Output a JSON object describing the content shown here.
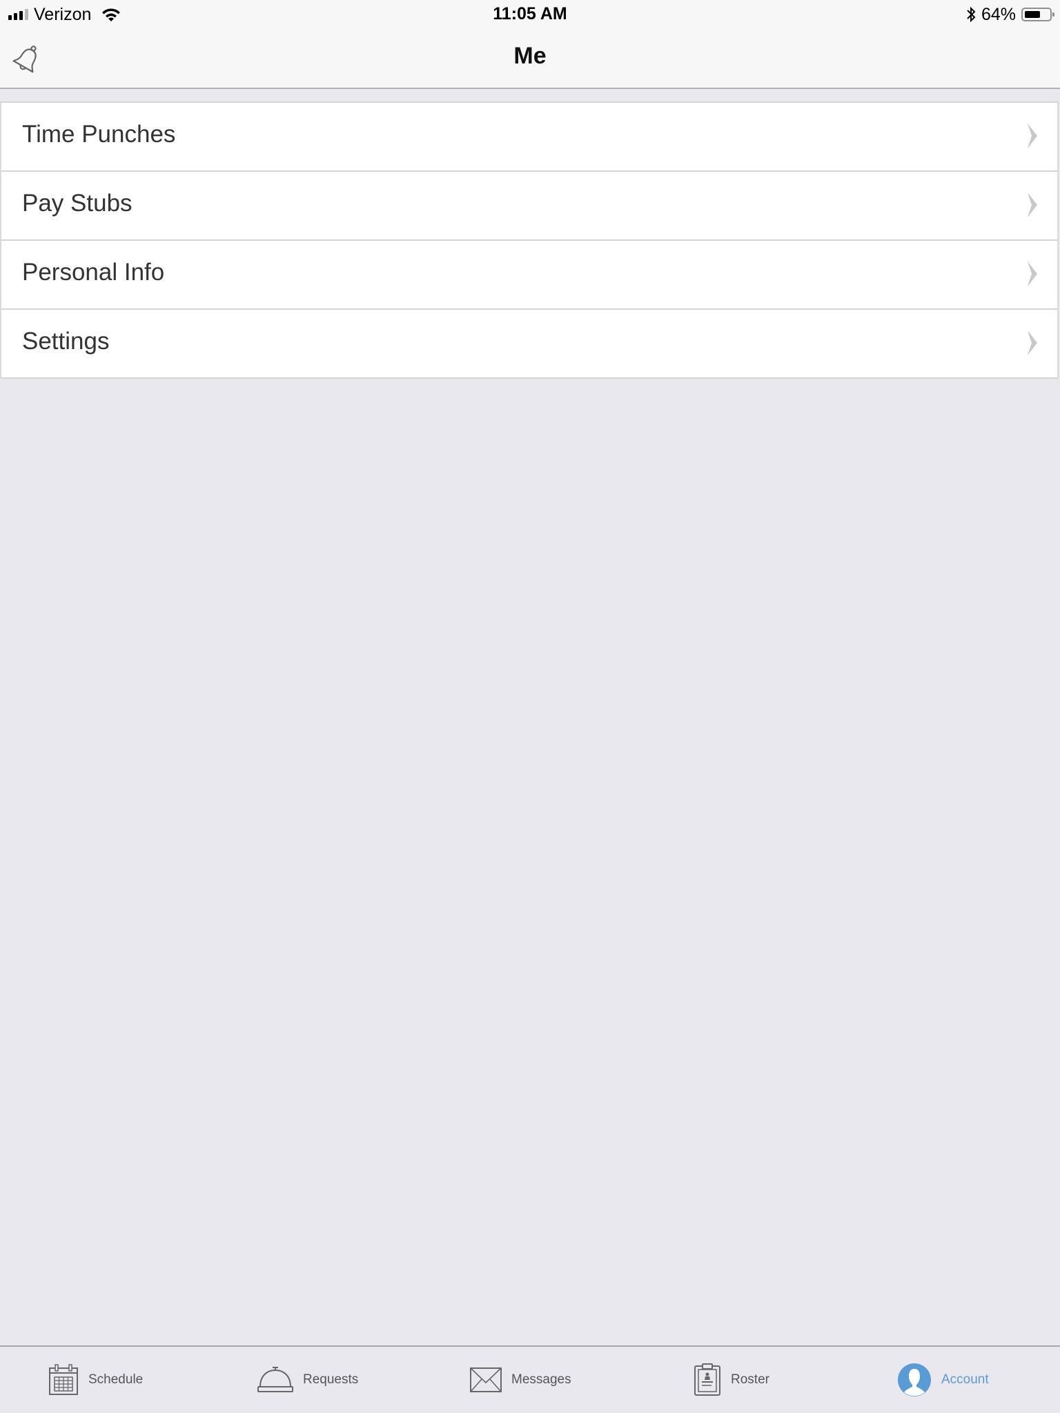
{
  "status_bar": {
    "carrier": "Verizon",
    "signal_bars": 3,
    "signal_max": 4,
    "time": "11:05 AM",
    "battery_text": "64%",
    "battery_level": 0.64
  },
  "nav": {
    "title": "Me",
    "left_icon": "bell-icon"
  },
  "menu": {
    "items": [
      {
        "label": "Time Punches",
        "icon": "chevron-right-icon"
      },
      {
        "label": "Pay Stubs",
        "icon": "chevron-right-icon"
      },
      {
        "label": "Personal Info",
        "icon": "chevron-right-icon"
      },
      {
        "label": "Settings",
        "icon": "chevron-right-icon"
      }
    ]
  },
  "tab_bar": {
    "active": "Account",
    "active_color": "#5b9bd5",
    "tabs": [
      {
        "label": "Schedule",
        "icon": "calendar-icon"
      },
      {
        "label": "Requests",
        "icon": "service-bell-icon"
      },
      {
        "label": "Messages",
        "icon": "envelope-icon"
      },
      {
        "label": "Roster",
        "icon": "clipboard-badge-icon"
      },
      {
        "label": "Account",
        "icon": "user-avatar-icon"
      }
    ]
  }
}
